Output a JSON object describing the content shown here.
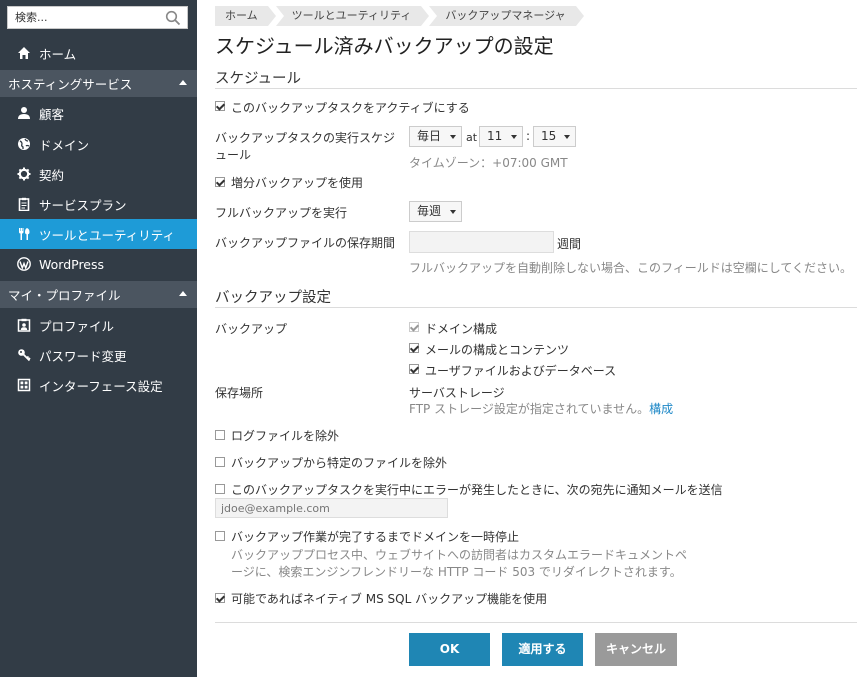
{
  "search": {
    "placeholder": "検索..."
  },
  "sidebar": {
    "home": "ホーム",
    "sections": [
      {
        "title": "ホスティングサービス",
        "items": [
          {
            "label": "顧客",
            "icon": "user-icon"
          },
          {
            "label": "ドメイン",
            "icon": "globe-icon"
          },
          {
            "label": "契約",
            "icon": "gear-icon"
          },
          {
            "label": "サービスプラン",
            "icon": "clipboard-icon"
          },
          {
            "label": "ツールとユーティリティ",
            "icon": "tools-icon",
            "active": true
          },
          {
            "label": "WordPress",
            "icon": "wordpress-icon"
          }
        ]
      },
      {
        "title": "マイ・プロファイル",
        "items": [
          {
            "label": "プロファイル",
            "icon": "profile-icon"
          },
          {
            "label": "パスワード変更",
            "icon": "key-icon"
          },
          {
            "label": "インターフェース設定",
            "icon": "grid-icon"
          }
        ]
      }
    ]
  },
  "breadcrumb": [
    "ホーム",
    "ツールとユーティリティ",
    "バックアップマネージャ"
  ],
  "page": {
    "title": "スケジュール済みバックアップの設定"
  },
  "schedule": {
    "section_title": "スケジュール",
    "activate_label": "このバックアップタスクをアクティブにする",
    "activate_checked": true,
    "run_schedule_label_1": "バックアップタスクの実行スケジ",
    "run_schedule_label_2": "ュール",
    "frequency": "毎日",
    "at": "at",
    "hour": "11",
    "sep": ":",
    "minute": "15",
    "timezone": "タイムゾーン：+07:00 GMT",
    "incremental_label": "増分バックアップを使用",
    "incremental_checked": true,
    "full_backup_label": "フルバックアップを実行",
    "full_backup_value": "毎週",
    "retention_label": "バックアップファイルの保存期間",
    "retention_value": "",
    "retention_unit": "週間",
    "retention_hint": "フルバックアップを自動削除しない場合、このフィールドは空欄にしてください。"
  },
  "backup_settings": {
    "section_title": "バックアップ設定",
    "backup_label": "バックアップ",
    "options": [
      {
        "label": "ドメイン構成",
        "checked": true,
        "disabled": true
      },
      {
        "label": "メールの構成とコンテンツ",
        "checked": true,
        "disabled": false
      },
      {
        "label": "ユーザファイルおよびデータベース",
        "checked": true,
        "disabled": false
      }
    ],
    "storage_label": "保存場所",
    "storage_value": "サーバストレージ",
    "ftp_note": "FTP ストレージ設定が指定されていません。",
    "ftp_link": "構成",
    "exclude_logs": "ログファイルを除外",
    "exclude_files": "バックアップから特定のファイルを除外",
    "notify_label": "このバックアップタスクを実行中にエラーが発生したときに、次の宛先に通知メールを送信",
    "notify_email_placeholder": "jdoe@example.com",
    "suspend_label": "バックアップ作業が完了するまでドメインを一時停止",
    "suspend_hint_1": "バックアッププロセス中、ウェブサイトへの訪問者はカスタムエラードキュメントペ",
    "suspend_hint_2": "ージに、検索エンジンフレンドリーな HTTP コード 503 でリダイレクトされます。",
    "mssql_label": "可能であればネイティブ MS SQL バックアップ機能を使用",
    "mssql_checked": true
  },
  "buttons": {
    "ok": "OK",
    "apply": "適用する",
    "cancel": "キャンセル"
  },
  "colors": {
    "sidebar_bg": "#323c46",
    "section_bg": "#4b5560",
    "active": "#1e9bd7",
    "primary_button": "#1f86b4",
    "cancel_button": "#9a9a9a",
    "link": "#1e88c7"
  }
}
